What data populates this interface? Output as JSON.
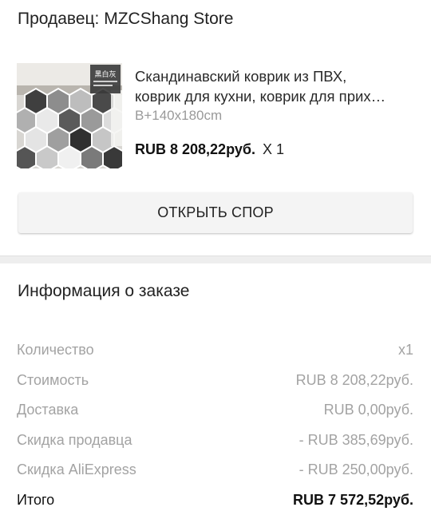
{
  "seller": {
    "label": "Продавец: MZCShang Store"
  },
  "product": {
    "title_line1": "Скандинавский коврик из ПВХ,",
    "title_line2": "коврик для кухни, коврик для прих…",
    "variant": "B+140x180cm",
    "price": "RUB 8 208,22руб.",
    "quantity": "X 1",
    "thumbnail_badge": "黑白灰",
    "thumbnail_icon": "hexagon-rug-image"
  },
  "dispute_button": {
    "label": "ОТКРЫТЬ СПОР"
  },
  "order_info": {
    "title": "Информация о заказе",
    "rows": [
      {
        "label": "Количество",
        "value": "x1"
      },
      {
        "label": "Стоимость",
        "value": "RUB 8 208,22руб."
      },
      {
        "label": "Доставка",
        "value": "RUB 0,00руб."
      },
      {
        "label": "Скидка продавца",
        "value": "- RUB 385,69руб."
      },
      {
        "label": "Скидка AliExpress",
        "value": "- RUB 250,00руб."
      },
      {
        "label": "Итого",
        "value": "RUB 7 572,52руб."
      }
    ]
  }
}
